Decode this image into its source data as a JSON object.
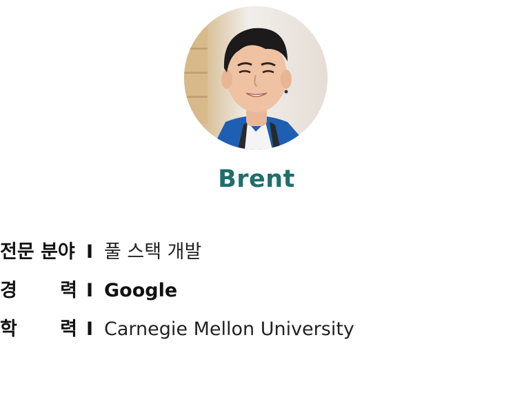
{
  "profile": {
    "name": "Brent"
  },
  "details": [
    {
      "label": "전문 분야",
      "label_parts": [
        "전문 분야"
      ],
      "separator": "I",
      "value": "풀 스택 개발"
    },
    {
      "label": "경 력",
      "label_parts": [
        "경",
        "력"
      ],
      "separator": "I",
      "value": "Google"
    },
    {
      "label": "학 력",
      "label_parts": [
        "학",
        "력"
      ],
      "separator": "I",
      "value": "Carnegie Mellon University"
    }
  ],
  "colors": {
    "name_accent": "#1f6f6b",
    "text": "#111111"
  }
}
